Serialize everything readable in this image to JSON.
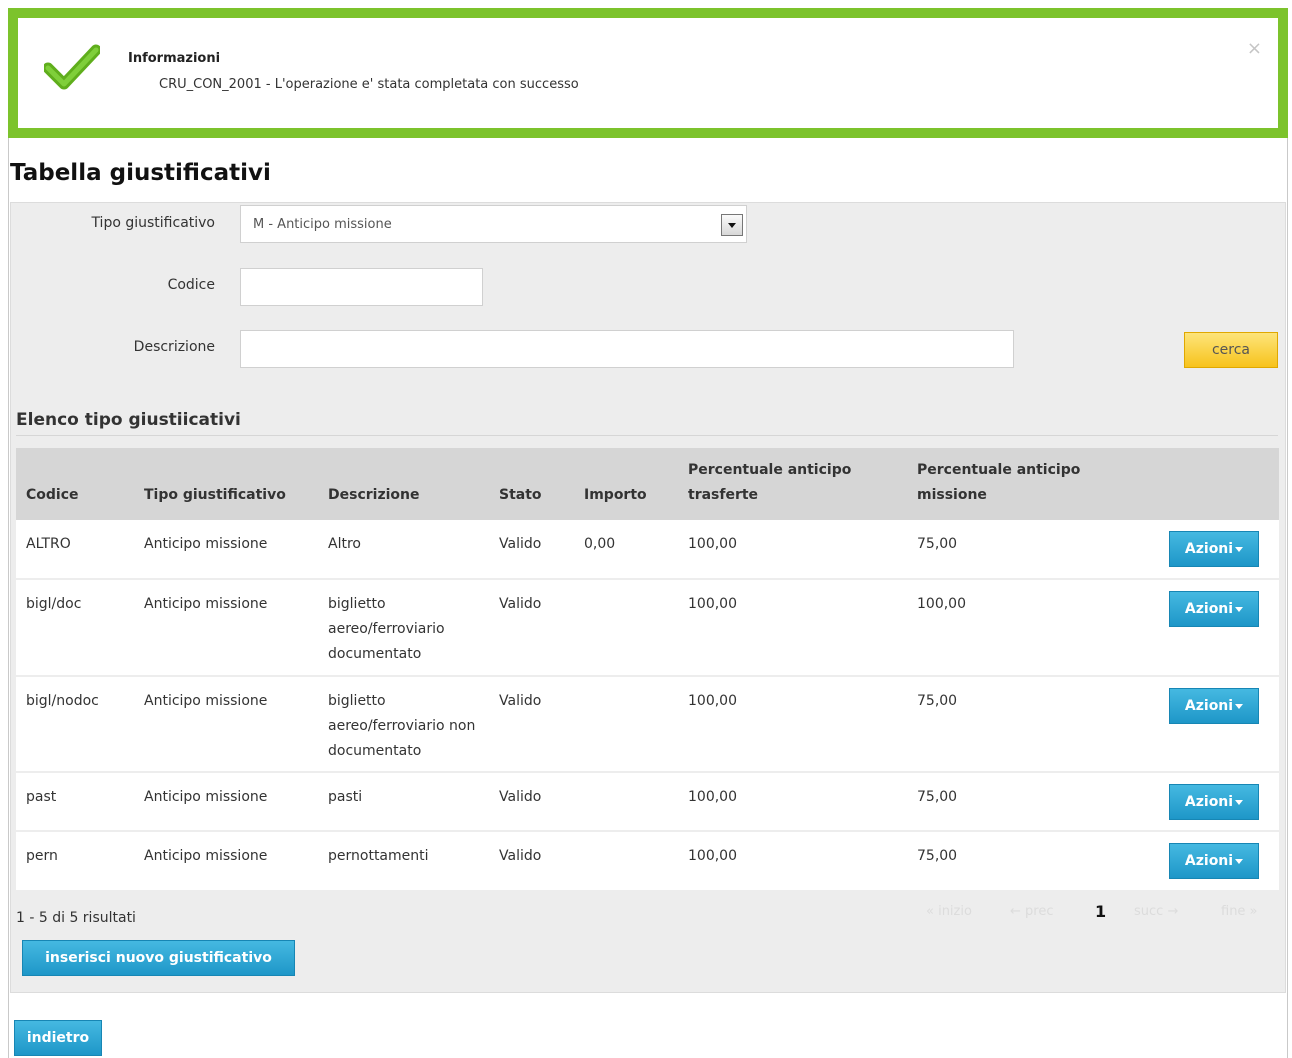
{
  "alert": {
    "title": "Informazioni",
    "message": "CRU_CON_2001 - L'operazione e' stata completata con successo",
    "close": "×",
    "border_color": "#7cc32c"
  },
  "page_title": "Tabella giustificativi",
  "search": {
    "tipo_label": "Tipo giustificativo",
    "tipo_value": "M - Anticipo missione",
    "codice_label": "Codice",
    "codice_value": "",
    "descrizione_label": "Descrizione",
    "descrizione_value": "",
    "cerca_label": "cerca"
  },
  "list": {
    "section_title": "Elenco tipo giustiicativi",
    "columns": {
      "codice": "Codice",
      "tipo": "Tipo giustificativo",
      "descrizione": "Descrizione",
      "stato": "Stato",
      "importo": "Importo",
      "perc_trasferte": "Percentuale anticipo trasferte",
      "perc_missione": "Percentuale anticipo missione"
    },
    "rows": [
      {
        "codice": "ALTRO",
        "tipo": "Anticipo missione",
        "descrizione": "Altro",
        "stato": "Valido",
        "importo": "0,00",
        "perc_trasferte": "100,00",
        "perc_missione": "75,00",
        "azioni": "Azioni"
      },
      {
        "codice": "bigl/doc",
        "tipo": "Anticipo missione",
        "descrizione": "biglietto aereo/ferroviario documentato",
        "stato": "Valido",
        "importo": "",
        "perc_trasferte": "100,00",
        "perc_missione": "100,00",
        "azioni": "Azioni"
      },
      {
        "codice": "bigl/nodoc",
        "tipo": "Anticipo missione",
        "descrizione": "biglietto aereo/ferroviario non documentato",
        "stato": "Valido",
        "importo": "",
        "perc_trasferte": "100,00",
        "perc_missione": "75,00",
        "azioni": "Azioni"
      },
      {
        "codice": "past",
        "tipo": "Anticipo missione",
        "descrizione": "pasti",
        "stato": "Valido",
        "importo": "",
        "perc_trasferte": "100,00",
        "perc_missione": "75,00",
        "azioni": "Azioni"
      },
      {
        "codice": "pern",
        "tipo": "Anticipo missione",
        "descrizione": "pernottamenti",
        "stato": "Valido",
        "importo": "",
        "perc_trasferte": "100,00",
        "perc_missione": "75,00",
        "azioni": "Azioni"
      }
    ],
    "results_text": "1 - 5 di 5 risultati",
    "pager": {
      "first": "« inizio",
      "prev": "← prec",
      "current": "1",
      "next": "succ →",
      "last": "fine »"
    }
  },
  "buttons": {
    "new": "inserisci nuovo giustificativo",
    "back": "indietro"
  }
}
